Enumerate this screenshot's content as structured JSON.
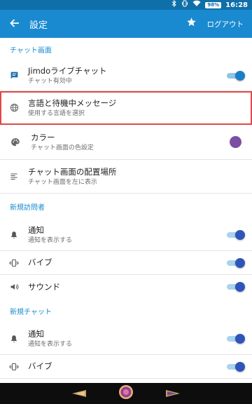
{
  "status_bar": {
    "icons": [
      "bluetooth-icon",
      "vibrate-icon",
      "wifi-icon"
    ],
    "battery": "98%",
    "time": "16:28"
  },
  "app_bar": {
    "title": "設定",
    "back_icon": "arrow-back-icon",
    "star_icon": "star-icon",
    "logout_label": "ログアウト"
  },
  "sections": {
    "chat_screen": {
      "header": "チャット画面",
      "jimdo_chat": {
        "title": "Jimdoライブチャット",
        "subtitle": "チャット有効中",
        "enabled": true
      },
      "language": {
        "title": "言語と待機中メッセージ",
        "subtitle": "使用する言語を選択"
      },
      "color": {
        "title": "カラー",
        "subtitle": "チャット画面の色設定",
        "value": "#7b4fa2"
      },
      "placement": {
        "title": "チャット画面の配置場所",
        "subtitle": "チャット画面を左に表示"
      }
    },
    "new_visitor": {
      "header": "新規訪問者",
      "notify": {
        "title": "通知",
        "subtitle": "通知を表示する",
        "enabled": true
      },
      "vibrate": {
        "title": "バイブ",
        "enabled": true
      },
      "sound": {
        "title": "サウンド",
        "enabled": true
      }
    },
    "new_chat": {
      "header": "新規チャット",
      "notify": {
        "title": "通知",
        "subtitle": "通知を表示する",
        "enabled": true
      },
      "vibrate": {
        "title": "バイブ",
        "enabled": true
      }
    }
  },
  "colors": {
    "accent": "#1a8ad0",
    "status_bar": "#0f6fa8",
    "highlight_border": "#e04848",
    "toggle_on": "#1a7fc4"
  }
}
